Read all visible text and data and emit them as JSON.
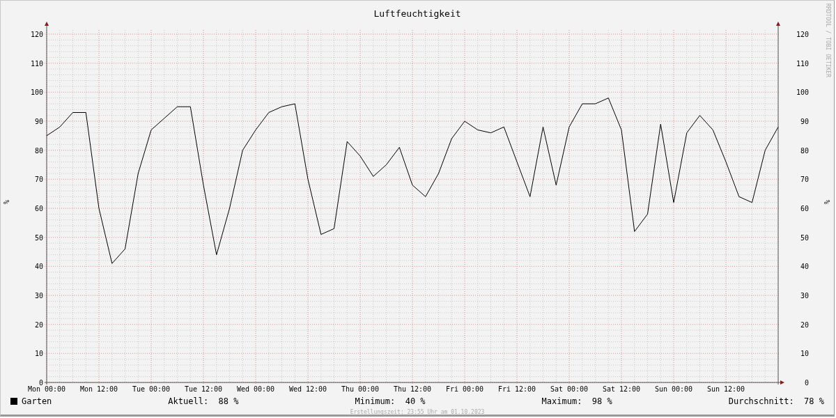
{
  "graph": {
    "credit": "RRDTOOL / TOBI OETIKER",
    "right_axis_label": "%",
    "chart_data": {
      "type": "line",
      "title": "Luftfeuchtigkeit",
      "ylabel": "%",
      "categories": [
        "Mon 00:00",
        null,
        null,
        null,
        "Mon 12:00",
        null,
        null,
        null,
        "Tue 00:00",
        null,
        null,
        null,
        "Tue 12:00",
        null,
        null,
        null,
        "Wed 00:00",
        null,
        null,
        null,
        "Wed 12:00",
        null,
        null,
        null,
        "Thu 00:00",
        null,
        null,
        null,
        "Thu 12:00",
        null,
        null,
        null,
        "Fri 00:00",
        null,
        null,
        null,
        "Fri 12:00",
        null,
        null,
        null,
        "Sat 00:00",
        null,
        null,
        null,
        "Sat 12:00",
        null,
        null,
        null,
        "Sun 00:00",
        null,
        null,
        null,
        "Sun 12:00",
        null,
        null,
        null,
        null
      ],
      "series": [
        {
          "name": "Garten",
          "color": "#000000",
          "values": [
            85,
            88,
            93,
            93,
            60,
            41,
            46,
            72,
            87,
            91,
            95,
            95,
            68,
            44,
            60,
            80,
            87,
            93,
            95,
            96,
            70,
            51,
            53,
            83,
            78,
            71,
            75,
            81,
            68,
            64,
            72,
            84,
            90,
            87,
            86,
            88,
            76,
            64,
            88,
            68,
            88,
            96,
            96,
            98,
            87,
            52,
            58,
            89,
            62,
            86,
            92,
            87,
            76,
            64,
            62,
            80,
            88
          ]
        }
      ],
      "ylim": [
        0,
        120
      ],
      "grid": true,
      "yticks": [
        120,
        110,
        100,
        90,
        80,
        70,
        60,
        50,
        40,
        30,
        20,
        10,
        0
      ]
    },
    "right_yticks": [
      "120",
      "110",
      "100",
      "90",
      "80",
      "70",
      "60",
      "50",
      "40",
      "30",
      "20",
      "10",
      "0"
    ]
  },
  "stats": [
    {
      "label": "Aktuell:",
      "value": "88 %"
    },
    {
      "label": "Minimum:",
      "value": "40 %"
    },
    {
      "label": "Maximum:",
      "value": "98 %"
    },
    {
      "label": "Durchschnitt:",
      "value": "78 %"
    }
  ],
  "footer": "Erstellungszeit: 23:55 Uhr am 01.10.2023"
}
